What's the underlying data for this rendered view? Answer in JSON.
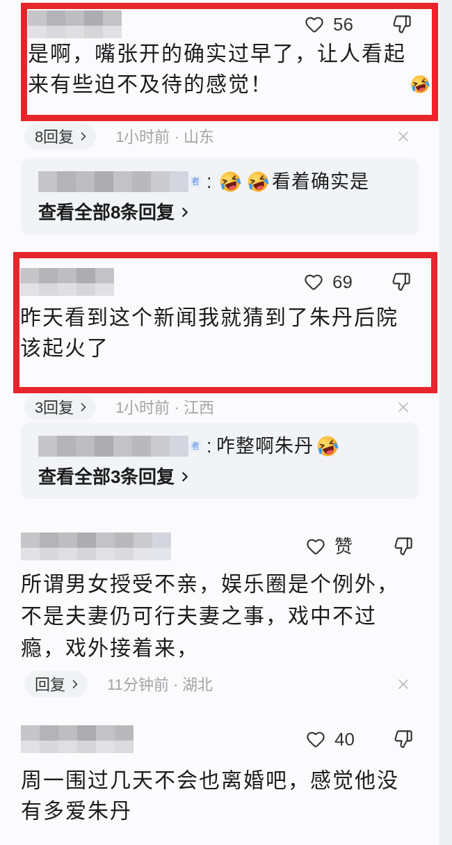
{
  "comments": [
    {
      "highlighted": true,
      "likes": "56",
      "body": [
        {
          "kind": "text",
          "text": "是啊，嘴张开的确实过早了，让人看起来有些迫不及待的感觉！"
        },
        {
          "kind": "emoji"
        }
      ],
      "reply_button": "8回复",
      "meta": "1小时前 · 山东",
      "reply_preview": {
        "badge": "者",
        "separator": ":",
        "content": [
          {
            "kind": "emoji"
          },
          {
            "kind": "emoji"
          },
          {
            "kind": "text",
            "text": "看着确实是"
          }
        ],
        "view_all": "查看全部8条回复"
      }
    },
    {
      "highlighted": true,
      "likes": "69",
      "body": [
        {
          "kind": "text",
          "text": "昨天看到这个新闻我就猜到了朱丹后院该起火了"
        }
      ],
      "reply_button": "3回复",
      "meta": "1小时前 · 江西",
      "reply_preview": {
        "badge": "者",
        "separator": ":",
        "content": [
          {
            "kind": "text",
            "text": "咋整啊朱丹"
          },
          {
            "kind": "emoji"
          }
        ],
        "view_all": "查看全部3条回复"
      }
    },
    {
      "highlighted": false,
      "likes": "赞",
      "body": [
        {
          "kind": "text",
          "text": "所谓男女授受不亲，娱乐圈是个例外，不是夫妻仍可行夫妻之事，戏中不过瘾，戏外接着来，"
        }
      ],
      "reply_button": "回复",
      "meta": "11分钟前 · 湖北"
    },
    {
      "highlighted": false,
      "likes": "40",
      "body": [
        {
          "kind": "text",
          "text": "周一围过几天不会也离婚吧，感觉他没有多爱朱丹"
        }
      ]
    }
  ]
}
